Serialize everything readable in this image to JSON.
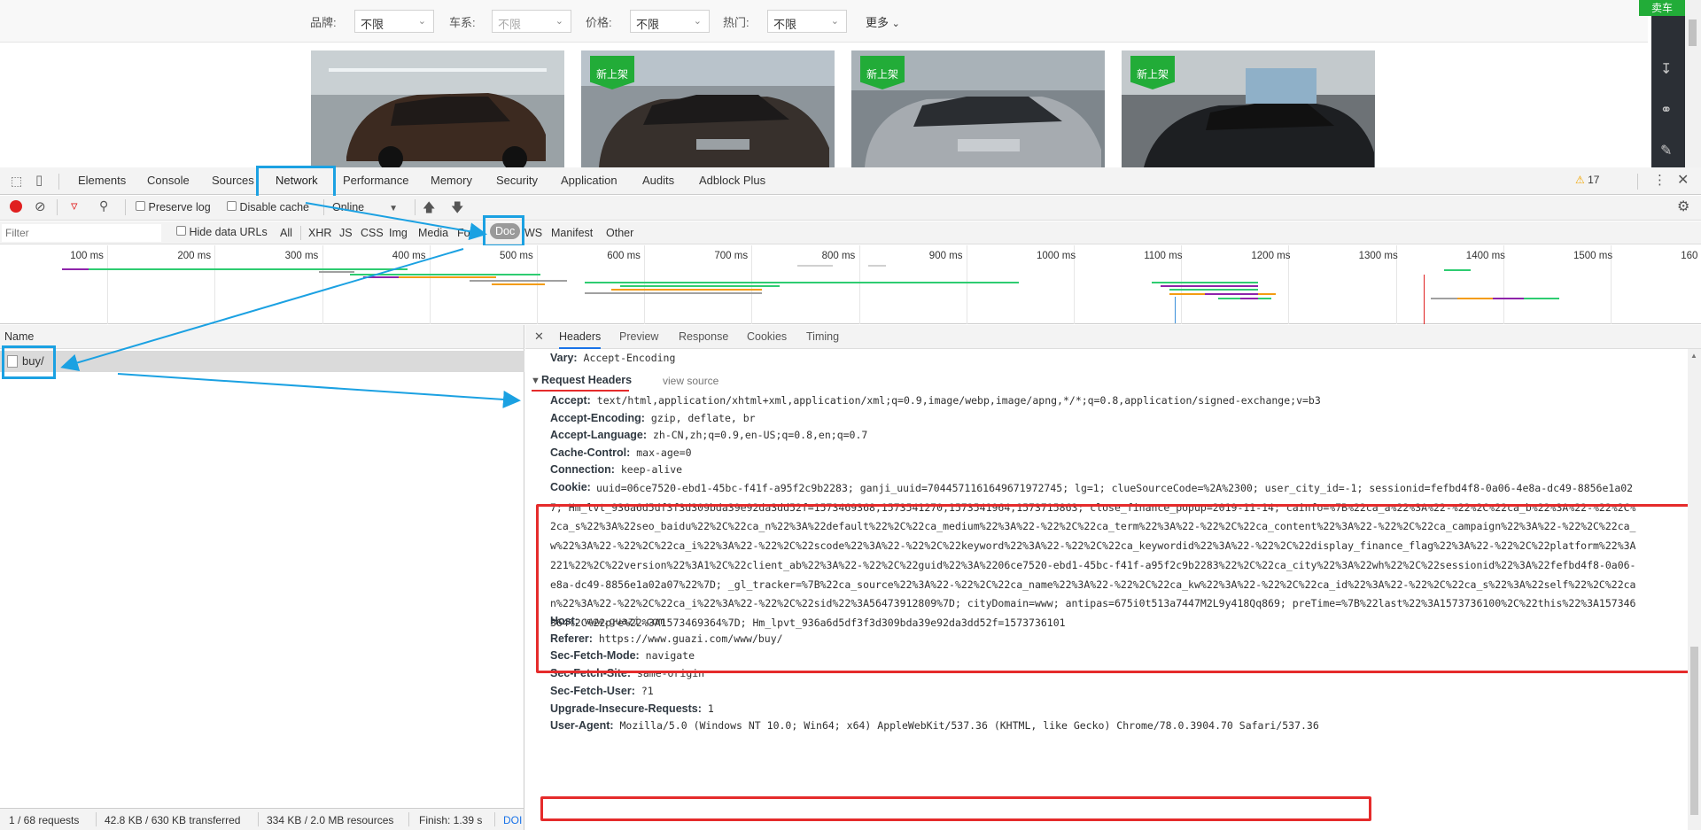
{
  "page": {
    "filters": [
      {
        "label": "品牌:",
        "value": "不限",
        "disabled": false
      },
      {
        "label": "车系:",
        "value": "不限",
        "disabled": true
      },
      {
        "label": "价格:",
        "value": "不限",
        "disabled": false
      },
      {
        "label": "热门:",
        "value": "不限",
        "disabled": false
      }
    ],
    "more_label": "更多",
    "sell_label": "卖车",
    "cards": [
      {
        "badge": ""
      },
      {
        "badge": "新上架"
      },
      {
        "badge": "新上架"
      },
      {
        "badge": "新上架"
      }
    ]
  },
  "devtools": {
    "tabs": [
      "Elements",
      "Console",
      "Sources",
      "Network",
      "Performance",
      "Memory",
      "Security",
      "Application",
      "Audits",
      "Adblock Plus"
    ],
    "active_tab": "Network",
    "warning_count": "17",
    "toolbar": {
      "preserve_log": "Preserve log",
      "disable_cache": "Disable cache",
      "throttle": "Online"
    },
    "filter": {
      "placeholder": "Filter",
      "hide_data_urls": "Hide data URLs",
      "types": [
        "All",
        "XHR",
        "JS",
        "CSS",
        "Img",
        "Media",
        "Font",
        "Doc",
        "WS",
        "Manifest",
        "Other"
      ],
      "active_type": "Doc"
    },
    "timeline_ticks": [
      "100 ms",
      "200 ms",
      "300 ms",
      "400 ms",
      "500 ms",
      "600 ms",
      "700 ms",
      "800 ms",
      "900 ms",
      "1000 ms",
      "1100 ms",
      "1200 ms",
      "1300 ms",
      "1400 ms",
      "1500 ms",
      "160"
    ],
    "name_header": "Name",
    "request_name": "buy/",
    "status": {
      "requests": "1 / 68 requests",
      "transferred": "42.8 KB / 630 KB transferred",
      "resources": "334 KB / 2.0 MB resources",
      "finish": "Finish: 1.39 s",
      "dom": "DOI"
    },
    "detail_tabs": [
      "Headers",
      "Preview",
      "Response",
      "Cookies",
      "Timing"
    ],
    "active_detail_tab": "Headers",
    "vary": {
      "key": "Vary:",
      "value": "Accept-Encoding"
    },
    "request_headers_title": "Request Headers",
    "view_source": "view source",
    "headers_before_cookie": [
      {
        "key": "Accept:",
        "value": "text/html,application/xhtml+xml,application/xml;q=0.9,image/webp,image/apng,*/*;q=0.8,application/signed-exchange;v=b3"
      },
      {
        "key": "Accept-Encoding:",
        "value": "gzip, deflate, br"
      },
      {
        "key": "Accept-Language:",
        "value": "zh-CN,zh;q=0.9,en-US;q=0.8,en;q=0.7"
      },
      {
        "key": "Cache-Control:",
        "value": "max-age=0"
      },
      {
        "key": "Connection:",
        "value": "keep-alive"
      }
    ],
    "cookie_key": "Cookie:",
    "cookie_lines": [
      "uuid=06ce7520-ebd1-45bc-f41f-a95f2c9b2283; ganji_uuid=7044571161649671972745; lg=1; clueSourceCode=%2A%2300; user_city_id=-1; sessionid=fefbd4f8-0a06-4e8a-dc49-8856e1a02",
      "7; Hm_lvt_936a6d5df3f3d309bda39e92da3dd52f=1573469368,1573541270,1573541964,1573715863; close_finance_popup=2019-11-14; cainfo=%7B%22ca_a%22%3A%22-%22%2C%22ca_b%22%3A%22-%22%2C%",
      "2ca_s%22%3A%22seo_baidu%22%2C%22ca_n%22%3A%22default%22%2C%22ca_medium%22%3A%22-%22%2C%22ca_term%22%3A%22-%22%2C%22ca_content%22%3A%22-%22%2C%22ca_campaign%22%3A%22-%22%2C%22ca_",
      "w%22%3A%22-%22%2C%22ca_i%22%3A%22-%22%2C%22scode%22%3A%22-%22%2C%22keyword%22%3A%22-%22%2C%22ca_keywordid%22%3A%22-%22%2C%22display_finance_flag%22%3A%22-%22%2C%22platform%22%3A",
      "221%22%2C%22version%22%3A1%2C%22client_ab%22%3A%22-%22%2C%22guid%22%3A%2206ce7520-ebd1-45bc-f41f-a95f2c9b2283%22%2C%22ca_city%22%3A%22wh%22%2C%22sessionid%22%3A%22fefbd4f8-0a06-",
      "e8a-dc49-8856e1a02a07%22%7D; _gl_tracker=%7B%22ca_source%22%3A%22-%22%2C%22ca_name%22%3A%22-%22%2C%22ca_kw%22%3A%22-%22%2C%22ca_id%22%3A%22-%22%2C%22ca_s%22%3A%22self%22%2C%22ca",
      "n%22%3A%22-%22%2C%22ca_i%22%3A%22-%22%2C%22sid%22%3A56473912809%7D; cityDomain=www; antipas=675i0t513a7447M2L9y418Qq869; preTime=%7B%22last%22%3A1573736100%2C%22this%22%3A157346",
      "364%2C%22pre%22%3A1573469364%7D; Hm_lpvt_936a6d5df3f3d309bda39e92da3dd52f=1573736101"
    ],
    "headers_after_cookie": [
      {
        "key": "Host:",
        "value": "www.guazi.com"
      },
      {
        "key": "Referer:",
        "value": "https://www.guazi.com/www/buy/"
      },
      {
        "key": "Sec-Fetch-Mode:",
        "value": "navigate"
      },
      {
        "key": "Sec-Fetch-Site:",
        "value": "same-origin"
      },
      {
        "key": "Sec-Fetch-User:",
        "value": "?1"
      },
      {
        "key": "Upgrade-Insecure-Requests:",
        "value": "1"
      },
      {
        "key": "User-Agent:",
        "value": "Mozilla/5.0 (Windows NT 10.0; Win64; x64) AppleWebKit/537.36 (KHTML, like Gecko) Chrome/78.0.3904.70 Safari/537.36"
      }
    ]
  },
  "colors": {
    "highlight_red": "#e52b2b",
    "annotation_blue": "#1ba1e2",
    "brand_green": "#22ac38"
  }
}
